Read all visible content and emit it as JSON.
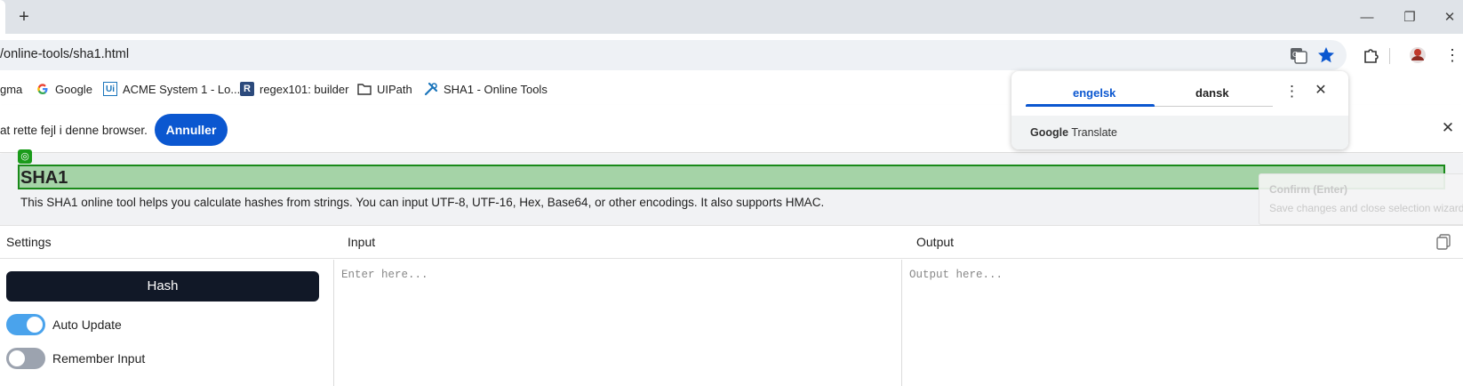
{
  "browser": {
    "new_tab_label": "+",
    "url": "/online-tools/sha1.html",
    "window_controls": {
      "minimize": "—",
      "restore": "❐",
      "close": "✕"
    }
  },
  "bookmarks": [
    {
      "label": "gma",
      "icon": "figma-icon"
    },
    {
      "label": "Google",
      "icon": "google-icon"
    },
    {
      "label": "ACME System 1 - Lo...",
      "icon": "uipath-icon"
    },
    {
      "label": "regex101: builder",
      "icon": "regex101-icon"
    },
    {
      "label": "UIPath",
      "icon": "folder-icon"
    },
    {
      "label": "SHA1 - Online Tools",
      "icon": "tools-icon"
    }
  ],
  "infobar": {
    "text": "at rette fejl i denne browser.",
    "button": "Annuller",
    "close": "✕"
  },
  "translate": {
    "tab_source": "engelsk",
    "tab_target": "dansk",
    "brand_google": "Google",
    "brand_translate": "Translate"
  },
  "page": {
    "title": "SHA1",
    "description": "This SHA1 online tool helps you calculate hashes from strings. You can input UTF-8, UTF-16, Hex, Base64, or other encodings. It also supports HMAC.",
    "tooltip_title": "Confirm (Enter)",
    "tooltip_text": "Save changes and close selection wizard.",
    "col_settings": "Settings",
    "col_input": "Input",
    "col_output": "Output",
    "hash_button": "Hash",
    "auto_update_label": "Auto Update",
    "auto_update_on": true,
    "remember_input_label": "Remember Input",
    "remember_input_on": false,
    "input_placeholder": "Enter here...",
    "output_placeholder": "Output here..."
  },
  "colors": {
    "accent_blue": "#0b57d0",
    "toggle_on": "#4aa3ec",
    "toggle_off": "#9ca3af",
    "selection_green": "#1a8a1a",
    "hash_button_bg": "#111827"
  }
}
